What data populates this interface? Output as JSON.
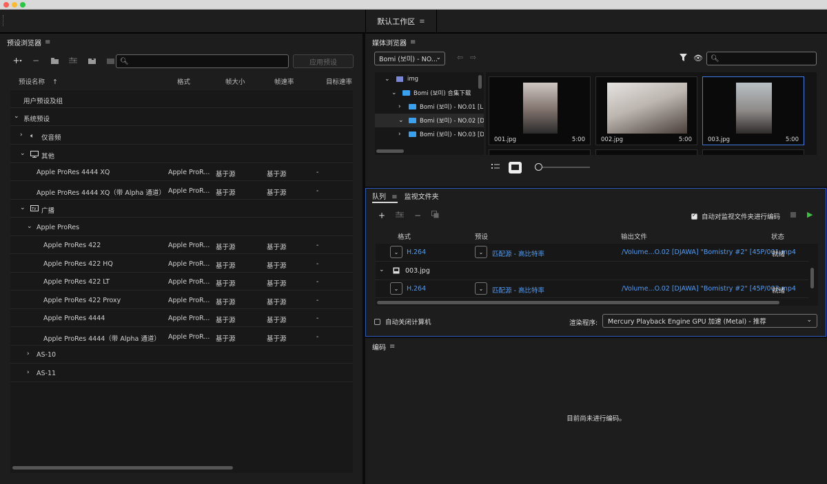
{
  "workspace": {
    "title": "默认工作区"
  },
  "preset_browser": {
    "title": "预设浏览器",
    "search_placeholder": "",
    "apply_label": "应用预设",
    "columns": [
      "预设名称",
      "格式",
      "帧大小",
      "帧速率",
      "目标速率"
    ],
    "rows": [
      {
        "name": "用户预设及组",
        "level": 0,
        "chevron": "",
        "icon": ""
      },
      {
        "name": "系统预设",
        "level": 0,
        "chevron": "down",
        "icon": ""
      },
      {
        "name": "仅音频",
        "level": 1,
        "chevron": "right",
        "icon": "speaker-icon"
      },
      {
        "name": "其他",
        "level": 1,
        "chevron": "down",
        "icon": "monitor-icon"
      },
      {
        "name": "Apple ProRes 4444 XQ",
        "level": 2,
        "format": "Apple ProR...",
        "frame_size": "基于源",
        "frame_rate": "基于源",
        "bitrate": "-"
      },
      {
        "name": "Apple ProRes 4444 XQ（带 Alpha 通道）",
        "level": 2,
        "format": "Apple ProR...",
        "frame_size": "基于源",
        "frame_rate": "基于源",
        "bitrate": "-"
      },
      {
        "name": "广播",
        "level": 1,
        "chevron": "down",
        "icon": "tv-icon"
      },
      {
        "name": "Apple ProRes",
        "level": 2,
        "chevron": "down",
        "icon": ""
      },
      {
        "name": "Apple ProRes 422",
        "level": 3,
        "format": "Apple ProR...",
        "frame_size": "基于源",
        "frame_rate": "基于源",
        "bitrate": "-"
      },
      {
        "name": "Apple ProRes 422 HQ",
        "level": 3,
        "format": "Apple ProR...",
        "frame_size": "基于源",
        "frame_rate": "基于源",
        "bitrate": "-"
      },
      {
        "name": "Apple ProRes 422 LT",
        "level": 3,
        "format": "Apple ProR...",
        "frame_size": "基于源",
        "frame_rate": "基于源",
        "bitrate": "-"
      },
      {
        "name": "Apple ProRes 422 Proxy",
        "level": 3,
        "format": "Apple ProR...",
        "frame_size": "基于源",
        "frame_rate": "基于源",
        "bitrate": "-"
      },
      {
        "name": "Apple ProRes 4444",
        "level": 3,
        "format": "Apple ProR...",
        "frame_size": "基于源",
        "frame_rate": "基于源",
        "bitrate": "-"
      },
      {
        "name": "Apple ProRes 4444（带 Alpha 通道）",
        "level": 3,
        "format": "Apple ProR...",
        "frame_size": "基于源",
        "frame_rate": "基于源",
        "bitrate": "-"
      },
      {
        "name": "AS-10",
        "level": 2,
        "chevron": "right",
        "icon": ""
      },
      {
        "name": "AS-11",
        "level": 2,
        "chevron": "right",
        "icon": ""
      }
    ]
  },
  "media_browser": {
    "title": "媒体浏览器",
    "location": "Bomi (보미) - NO...",
    "search_placeholder": "",
    "tree": [
      {
        "label": "img",
        "level": 0,
        "chevron": "down",
        "icon": "drive-icon"
      },
      {
        "label": "Bomi (보미) 合集下载",
        "level": 1,
        "chevron": "down",
        "icon": "folder-icon"
      },
      {
        "label": "Bomi (보미) - NO.01 [L",
        "level": 2,
        "chevron": "right",
        "icon": "folder-icon"
      },
      {
        "label": "Bomi (보미) - NO.02 [D",
        "level": 2,
        "chevron": "down",
        "icon": "folder-icon",
        "selected": true
      },
      {
        "label": "Bomi (보미) - NO.03 [D",
        "level": 2,
        "chevron": "right",
        "icon": "folder-icon"
      }
    ],
    "thumbnails": [
      {
        "name": "001.jpg",
        "duration": "5:00",
        "selected": false
      },
      {
        "name": "002.jpg",
        "duration": "5:00",
        "selected": false
      },
      {
        "name": "003.jpg",
        "duration": "5:00",
        "selected": true
      }
    ]
  },
  "queue": {
    "tab_queue": "队列",
    "tab_watch": "监视文件夹",
    "auto_encode_label": "自动对监视文件夹进行编码",
    "columns": [
      "格式",
      "预设",
      "输出文件",
      "状态"
    ],
    "items": [
      {
        "type": "encode",
        "format": "H.264",
        "preset": "匹配源 - 高比特率",
        "output": "/Volume...O.02 [DJAWA] \"Bomistry #2\" [45P/001.mp4",
        "status": "就绪"
      },
      {
        "type": "source",
        "name": "003.jpg"
      },
      {
        "type": "encode",
        "format": "H.264",
        "preset": "匹配源 - 高比特率",
        "output": "/Volume...O.02 [DJAWA] \"Bomistry #2\" [45P/003.mp4",
        "status": "就绪"
      }
    ],
    "auto_shutdown_label": "自动关闭计算机",
    "renderer_label": "渲染程序:",
    "renderer_value": "Mercury Playback Engine GPU 加速 (Metal) - 推荐"
  },
  "encoding": {
    "title": "编码",
    "empty_message": "目前尚未进行编码。"
  }
}
